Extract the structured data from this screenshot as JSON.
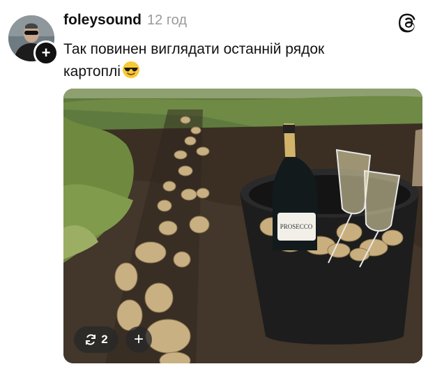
{
  "post": {
    "username": "foleysound",
    "timestamp": "12 год",
    "text_line1": "Так повинен виглядати останній рядок",
    "text_line2": "картоплі",
    "emoji": "smiling-face-with-sunglasses",
    "follow_symbol": "+",
    "repost_count": "2",
    "add_symbol": "+"
  },
  "photo": {
    "bottle_label": "PROSECCO"
  },
  "colors": {
    "username": "#111111",
    "timestamp": "#9a9a9a",
    "pill_bg": "#282828"
  }
}
